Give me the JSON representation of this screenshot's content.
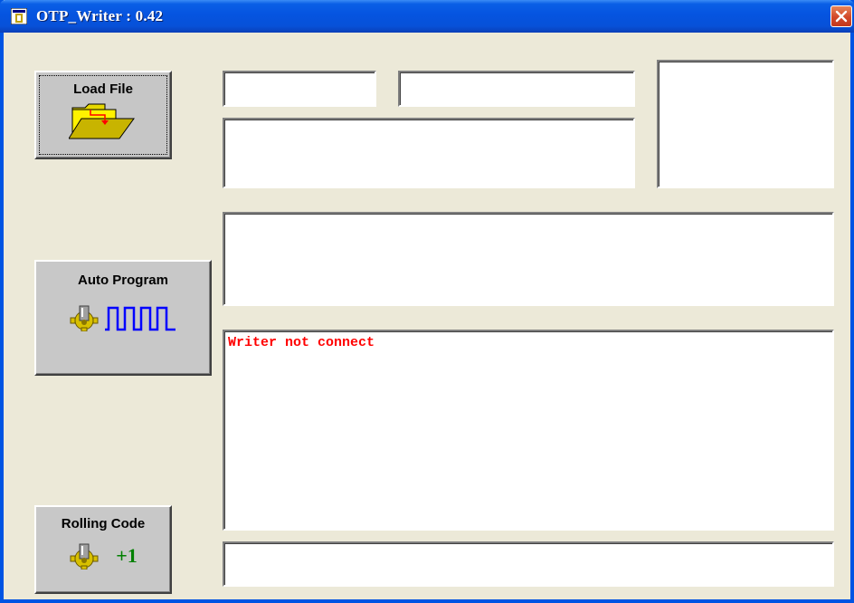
{
  "window": {
    "title": "OTP_Writer : 0.42",
    "close_label": "×"
  },
  "buttons": {
    "load_file": "Load File",
    "auto_program": "Auto Program",
    "rolling_code": "Rolling Code",
    "rolling_code_increment": "+1"
  },
  "fields": {
    "field_1": "",
    "field_2": "",
    "info": "",
    "preview": "",
    "message": "",
    "footer": ""
  },
  "log": {
    "status": "Writer not connect"
  },
  "colors": {
    "status_text": "#ff0000",
    "title_bar": "#0554e0",
    "window_bg": "#ece9d8"
  }
}
